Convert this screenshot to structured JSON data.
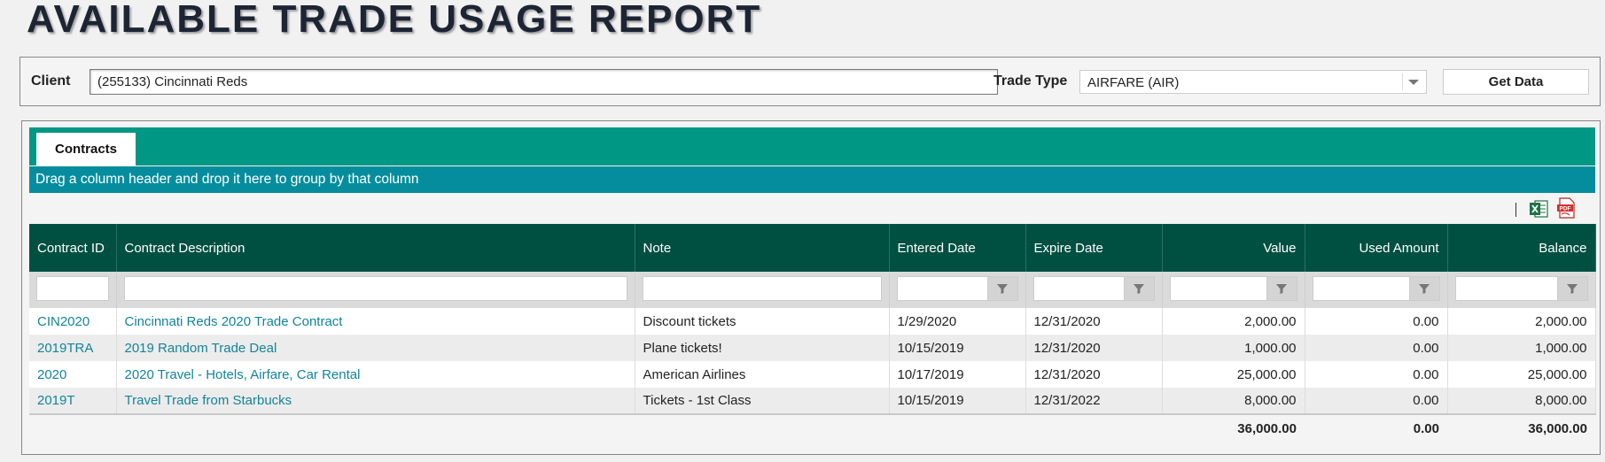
{
  "page": {
    "title": "AVAILABLE TRADE USAGE REPORT"
  },
  "filters": {
    "client_label": "Client",
    "client_value": "(255133) Cincinnati Reds",
    "trade_type_label": "Trade Type",
    "trade_type_value": "AIRFARE (AIR)",
    "get_data_label": "Get Data"
  },
  "tabs": [
    {
      "label": "Contracts",
      "active": true
    }
  ],
  "group_bar": {
    "text": "Drag a column header and drop it here to group by that column"
  },
  "toolbar": {
    "icons": [
      "excel-export-icon",
      "pdf-export-icon"
    ]
  },
  "grid": {
    "columns": [
      {
        "label": "Contract ID"
      },
      {
        "label": "Contract Description"
      },
      {
        "label": "Note"
      },
      {
        "label": "Entered Date"
      },
      {
        "label": "Expire Date"
      },
      {
        "label": "Value"
      },
      {
        "label": "Used Amount"
      },
      {
        "label": "Balance"
      }
    ],
    "rows": [
      {
        "id": "CIN2020",
        "description": "Cincinnati Reds 2020 Trade Contract",
        "note": "Discount tickets",
        "entered": "1/29/2020",
        "expire": "12/31/2020",
        "value": "2,000.00",
        "used": "0.00",
        "balance": "2,000.00"
      },
      {
        "id": "2019TRA",
        "description": "2019 Random Trade Deal",
        "note": "Plane tickets!",
        "entered": "10/15/2019",
        "expire": "12/31/2020",
        "value": "1,000.00",
        "used": "0.00",
        "balance": "1,000.00"
      },
      {
        "id": "2020",
        "description": "2020 Travel - Hotels, Airfare, Car Rental",
        "note": "American Airlines",
        "entered": "10/17/2019",
        "expire": "12/31/2020",
        "value": "25,000.00",
        "used": "0.00",
        "balance": "25,000.00"
      },
      {
        "id": "2019T",
        "description": "Travel Trade from Starbucks",
        "note": "Tickets - 1st Class",
        "entered": "10/15/2019",
        "expire": "12/31/2022",
        "value": "8,000.00",
        "used": "0.00",
        "balance": "8,000.00"
      }
    ],
    "totals": {
      "value": "36,000.00",
      "used": "0.00",
      "balance": "36,000.00"
    }
  },
  "colors": {
    "header": "#005042",
    "tabstrip": "#009784",
    "group_bar": "#068d9d",
    "link": "#12849a"
  }
}
